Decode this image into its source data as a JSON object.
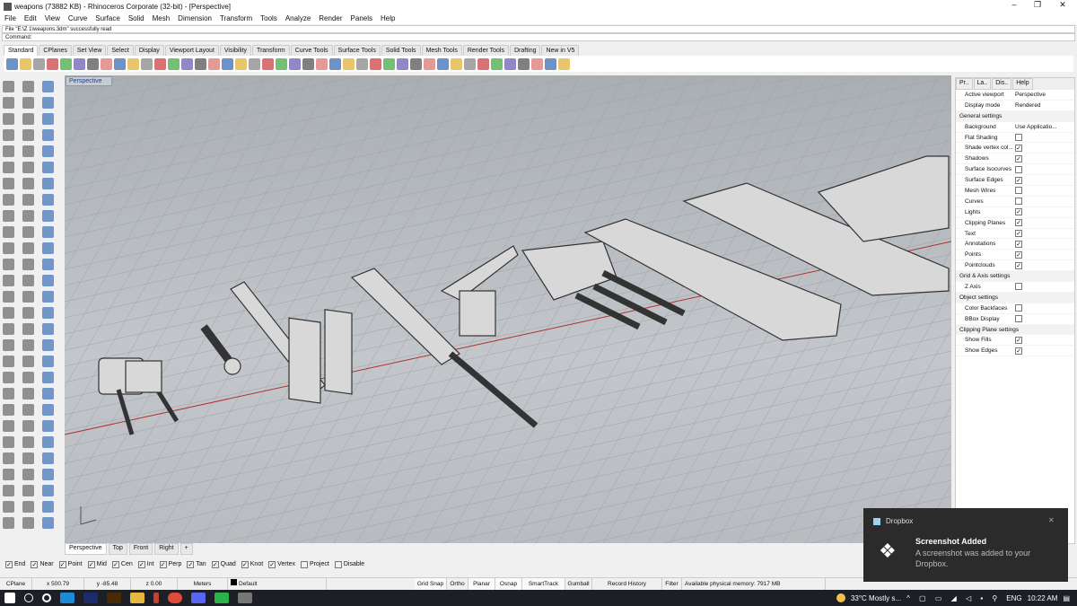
{
  "title": "weapons (73882 KB) - Rhinoceros Corporate (32-bit) - [Perspective]",
  "window_controls": [
    "–",
    "❐",
    "✕"
  ],
  "menu": [
    "File",
    "Edit",
    "View",
    "Curve",
    "Surface",
    "Solid",
    "Mesh",
    "Dimension",
    "Transform",
    "Tools",
    "Analyze",
    "Render",
    "Panels",
    "Help"
  ],
  "command_history": "File \"E:\\Z 1\\weapons.3dm\" successfully read",
  "command_prompt": "Command:",
  "toolbar_tabs": [
    "Standard",
    "CPlanes",
    "Set View",
    "Select",
    "Display",
    "Viewport Layout",
    "Visibility",
    "Transform",
    "Curve Tools",
    "Surface Tools",
    "Solid Tools",
    "Mesh Tools",
    "Render Tools",
    "Drafting",
    "New in V5"
  ],
  "viewport": {
    "label": "Perspective",
    "tabs": [
      "Perspective",
      "Top",
      "Front",
      "Right",
      "+"
    ]
  },
  "panel": {
    "tabs": [
      "Pr..",
      "La..",
      "Dis..",
      "Help"
    ],
    "rows": [
      {
        "type": "kv",
        "k": "Active viewport",
        "v": "Perspective"
      },
      {
        "type": "kv",
        "k": "Display mode",
        "v": "Rendered"
      },
      {
        "type": "sec",
        "k": "General settings"
      },
      {
        "type": "kv",
        "k": "Background",
        "v": "Use Applicatio..."
      },
      {
        "type": "cb",
        "k": "Flat Shading",
        "c": false
      },
      {
        "type": "cb",
        "k": "Shade vertex col...",
        "c": true
      },
      {
        "type": "cb",
        "k": "Shadows",
        "c": true
      },
      {
        "type": "cb",
        "k": "Surface Isocurves",
        "c": false
      },
      {
        "type": "cb",
        "k": "Surface Edges",
        "c": true
      },
      {
        "type": "cb",
        "k": "Mesh Wires",
        "c": false
      },
      {
        "type": "cb",
        "k": "Curves",
        "c": false
      },
      {
        "type": "cb",
        "k": "Lights",
        "c": true
      },
      {
        "type": "cb",
        "k": "Clipping Planes",
        "c": true
      },
      {
        "type": "cb",
        "k": "Text",
        "c": true
      },
      {
        "type": "cb",
        "k": "Annotations",
        "c": true
      },
      {
        "type": "cb",
        "k": "Points",
        "c": true
      },
      {
        "type": "cb",
        "k": "Pointclouds",
        "c": true
      },
      {
        "type": "sec",
        "k": "Grid & Axis settings"
      },
      {
        "type": "cb",
        "k": "Z Axis",
        "c": false
      },
      {
        "type": "sec",
        "k": "Object settings"
      },
      {
        "type": "cb",
        "k": "Color Backfaces",
        "c": false
      },
      {
        "type": "cb",
        "k": "BBox Display",
        "c": false
      },
      {
        "type": "sec",
        "k": "Clipping Plane settings"
      },
      {
        "type": "cb",
        "k": "Show Fills",
        "c": true
      },
      {
        "type": "cb",
        "k": "Show Edges",
        "c": true
      }
    ]
  },
  "osnap": [
    {
      "k": "End",
      "c": true
    },
    {
      "k": "Near",
      "c": true
    },
    {
      "k": "Point",
      "c": true
    },
    {
      "k": "Mid",
      "c": true
    },
    {
      "k": "Cen",
      "c": true
    },
    {
      "k": "Int",
      "c": true
    },
    {
      "k": "Perp",
      "c": true
    },
    {
      "k": "Tan",
      "c": true
    },
    {
      "k": "Quad",
      "c": true
    },
    {
      "k": "Knot",
      "c": true
    },
    {
      "k": "Vertex",
      "c": true
    },
    {
      "k": "Project",
      "c": false
    },
    {
      "k": "Disable",
      "c": false
    }
  ],
  "status": {
    "cplane": "CPlane",
    "x": "x 500.79",
    "y": "y -85.48",
    "z": "z 0.00",
    "units": "Meters",
    "layer": "Default",
    "grid_snap": "Grid Snap",
    "ortho": "Ortho",
    "planar": "Planar",
    "osnap": "Osnap",
    "smarttrack": "SmartTrack",
    "gumball": "Gumball",
    "record_history": "Record History",
    "filter": "Filter",
    "memory": "Available physical memory: 7917 MB"
  },
  "toast": {
    "app": "Dropbox",
    "title": "Screenshot Added",
    "body": "A screenshot was added to your Dropbox.",
    "close": "✕"
  },
  "taskbar": {
    "weather": "33°C  Mostly s...",
    "lang": "ENG",
    "time": "10:22 AM"
  },
  "colors": {
    "axis_red": "#b03030",
    "accent": "#1a3e8a",
    "toast_bg": "#2b2b2b"
  }
}
